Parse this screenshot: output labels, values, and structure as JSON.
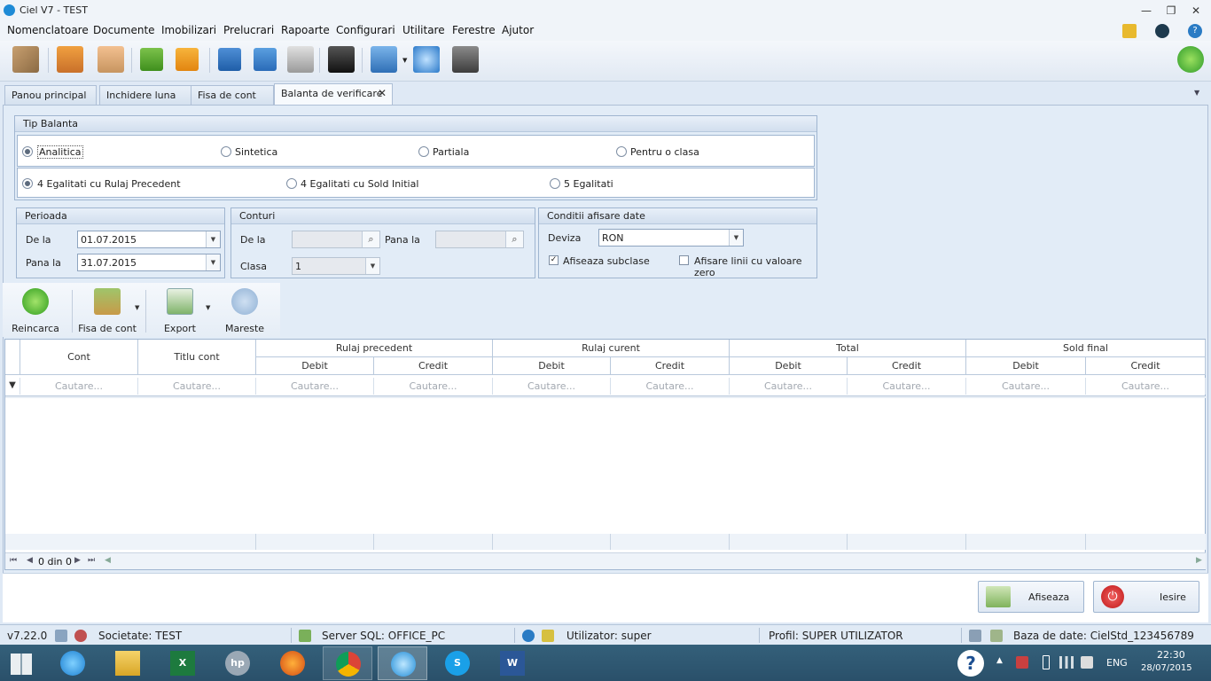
{
  "window": {
    "title": "Ciel V7 - TEST",
    "minimize": "—",
    "restore": "❐",
    "close": "✕"
  },
  "menu": [
    "Nomenclatoare",
    "Documente",
    "Imobilizari",
    "Prelucrari",
    "Rapoarte",
    "Configurari",
    "Utilitare",
    "Ferestre",
    "Ajutor"
  ],
  "tabs": [
    {
      "label": "Panou principal",
      "active": false
    },
    {
      "label": "Inchidere luna",
      "active": false
    },
    {
      "label": "Fisa de cont",
      "active": false
    },
    {
      "label": "Balanta de verificare",
      "active": true
    }
  ],
  "tab_close": "✕",
  "tip_balanta": {
    "title": "Tip Balanta",
    "row1": [
      {
        "label": "Analitica",
        "checked": true
      },
      {
        "label": "Sintetica",
        "checked": false
      },
      {
        "label": "Partiala",
        "checked": false
      },
      {
        "label": "Pentru o clasa",
        "checked": false
      }
    ],
    "row2": [
      {
        "label": "4 Egalitati cu Rulaj Precedent",
        "checked": true
      },
      {
        "label": "4 Egalitati cu Sold Initial",
        "checked": false
      },
      {
        "label": "5 Egalitati",
        "checked": false
      }
    ]
  },
  "perioada": {
    "title": "Perioada",
    "from_label": "De la",
    "from_value": "01.07.2015",
    "to_label": "Pana la",
    "to_value": "31.07.2015"
  },
  "conturi": {
    "title": "Conturi",
    "from_label": "De la",
    "to_label": "Pana la",
    "clasa_label": "Clasa",
    "clasa_value": "1"
  },
  "conditii": {
    "title": "Conditii afisare date",
    "deviza_label": "Deviza",
    "deviza_value": "RON",
    "subclase_label": "Afiseaza subclase",
    "subclase_checked": true,
    "zero_label": "Afisare linii cu valoare zero",
    "zero_checked": false
  },
  "ribbon": {
    "reincarca": "Reincarca",
    "fisa": "Fisa de cont",
    "export": "Export",
    "mareste": "Mareste"
  },
  "grid": {
    "col_cont": "Cont",
    "col_titlu": "Titlu cont",
    "groups": [
      "Rulaj precedent",
      "Rulaj curent",
      "Total",
      "Sold final"
    ],
    "debit": "Debit",
    "credit": "Credit",
    "filter_placeholder": "Cautare...",
    "nav_text": "0 din 0"
  },
  "buttons": {
    "afiseaza": "Afiseaza",
    "iesire": "Iesire"
  },
  "status": {
    "version": "v7.22.0",
    "societate": "Societate: TEST",
    "server": "Server SQL: OFFICE_PC",
    "utilizator": "Utilizator: super",
    "profil": "Profil: SUPER UTILIZATOR",
    "baza": "Baza de date: CielStd_123456789"
  },
  "taskbar": {
    "lang": "ENG",
    "time": "22:30",
    "date": "28/07/2015"
  },
  "colors": {
    "accent": "#1f8bd6",
    "tab_bg": "#dfe9f5",
    "taskbar": "#2e5670"
  }
}
